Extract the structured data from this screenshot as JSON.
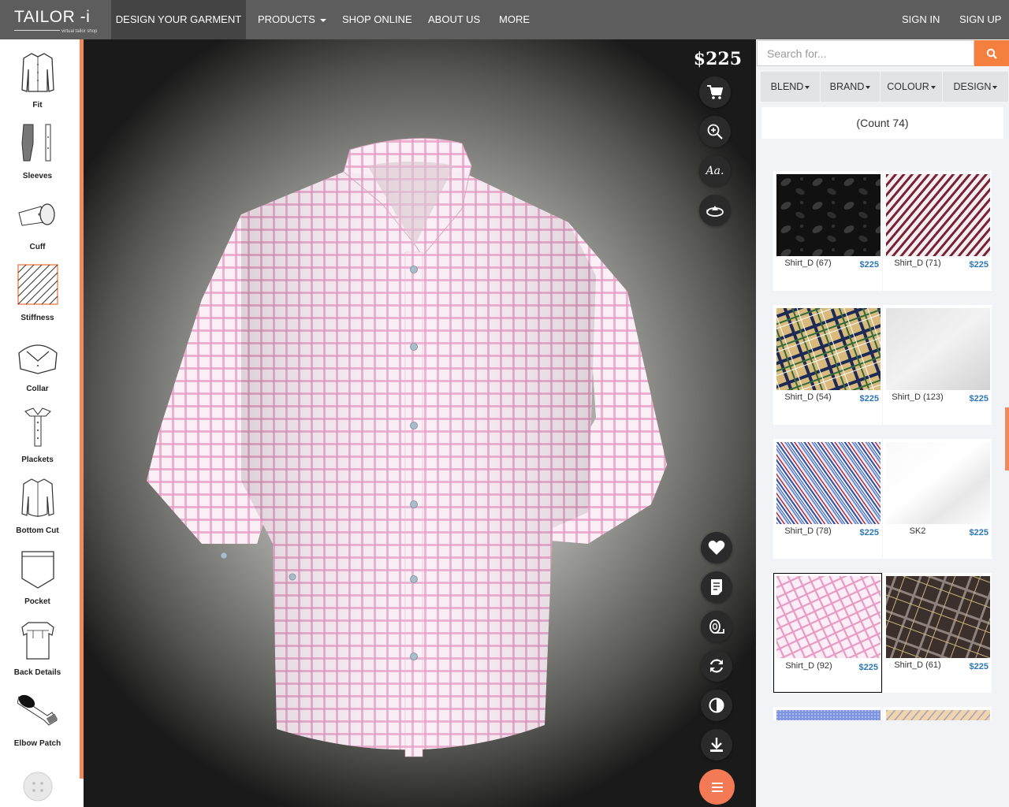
{
  "app": {
    "logo_text": "TAILOR -i",
    "logo_tagline": "virtual tailor shop"
  },
  "nav": {
    "items": [
      {
        "label": "DESIGN YOUR GARMENT"
      },
      {
        "label": "PRODUCTS"
      },
      {
        "label": "SHOP ONLINE"
      },
      {
        "label": "ABOUT US"
      },
      {
        "label": "MORE"
      }
    ],
    "sign_in": "SIGN IN",
    "sign_up": "SIGN UP"
  },
  "sidebar": {
    "items": [
      {
        "label": "Fit",
        "icon": "shirt-fit-icon"
      },
      {
        "label": "Sleeves",
        "icon": "sleeves-icon"
      },
      {
        "label": "Cuff",
        "icon": "cuff-icon"
      },
      {
        "label": "Stiffness",
        "icon": "stiffness-icon"
      },
      {
        "label": "Collar",
        "icon": "collar-icon"
      },
      {
        "label": "Plackets",
        "icon": "plackets-icon"
      },
      {
        "label": "Bottom Cut",
        "icon": "bottom-cut-icon"
      },
      {
        "label": "Pocket",
        "icon": "pocket-icon"
      },
      {
        "label": "Back Details",
        "icon": "back-details-icon"
      },
      {
        "label": "Elbow Patch",
        "icon": "elbow-patch-icon"
      },
      {
        "label": "",
        "icon": "button-icon"
      }
    ]
  },
  "canvas": {
    "price": "$225",
    "tools_top": [
      "cart-icon",
      "zoom-in-icon",
      "monogram-icon",
      "rotate-view-icon"
    ],
    "tools_bottom": [
      "heart-icon",
      "notes-icon",
      "fabric-roll-icon",
      "refresh-icon",
      "contrast-icon",
      "download-icon"
    ],
    "menu_icon": "menu-icon"
  },
  "panel": {
    "search_placeholder": "Search for...",
    "filters": [
      {
        "label": "BLEND"
      },
      {
        "label": "BRAND"
      },
      {
        "label": "COLOUR"
      },
      {
        "label": "DESIGN"
      }
    ],
    "count_text": "(Count 74)",
    "fabrics": [
      {
        "name": "Shirt_D (67)",
        "price": "$225",
        "pattern": "black-paisley"
      },
      {
        "name": "Shirt_D (71)",
        "price": "$225",
        "pattern": "maroon-stripe"
      },
      {
        "name": "Shirt_D (54)",
        "price": "$225",
        "pattern": "tan-plaid"
      },
      {
        "name": "Shirt_D (123)",
        "price": "$225",
        "pattern": "light-grey-solid"
      },
      {
        "name": "Shirt_D (78)",
        "price": "$225",
        "pattern": "blue-red-stripe"
      },
      {
        "name": "SK2",
        "price": "$225",
        "pattern": "white-solid"
      },
      {
        "name": "Shirt_D (92)",
        "price": "$225",
        "pattern": "pink-check",
        "selected": true
      },
      {
        "name": "Shirt_D (61)",
        "price": "$225",
        "pattern": "brown-plaid"
      }
    ]
  },
  "colors": {
    "nav_bg": "#5d5d5d",
    "accent": "#f47f3f",
    "price_blue": "#2e77b7",
    "shirt_check": "#e89ac4"
  }
}
